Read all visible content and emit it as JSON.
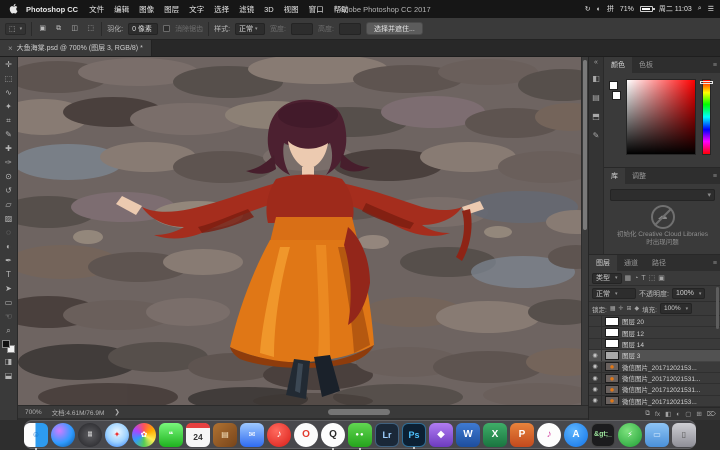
{
  "menubar": {
    "app_name": "Photoshop CC",
    "items": [
      "文件",
      "编辑",
      "图像",
      "图层",
      "文字",
      "选择",
      "滤镜",
      "3D",
      "视图",
      "窗口",
      "帮助"
    ],
    "window_title": "Adobe Photoshop CC 2017",
    "status_icons": {
      "sync": "↻",
      "display": "◐",
      "input": "拼",
      "search": "⌕",
      "notification": "☰"
    },
    "battery_pct": "71%",
    "clock": "周二 11:03"
  },
  "options_bar": {
    "tool_glyph": "⬚",
    "modes": [
      "▣",
      "⧉",
      "◫",
      "⬚"
    ],
    "feather_label": "羽化:",
    "feather_value": "0 像素",
    "antialias_label": "消除锯齿",
    "style_label": "样式:",
    "style_value": "正常",
    "width_label": "宽度:",
    "height_label": "高度:",
    "select_mask_button": "选择并遮住..."
  },
  "document_tab": {
    "close": "×",
    "title": "大鱼海棠.psd @ 700% (图层 3, RGB/8) *"
  },
  "tools": [
    {
      "name": "move-tool",
      "glyph": "✛"
    },
    {
      "name": "marquee-tool",
      "glyph": "⬚"
    },
    {
      "name": "lasso-tool",
      "glyph": "∿"
    },
    {
      "name": "magic-wand-tool",
      "glyph": "✦"
    },
    {
      "name": "crop-tool",
      "glyph": "⌗"
    },
    {
      "name": "eyedropper-tool",
      "glyph": "✎"
    },
    {
      "name": "healing-brush-tool",
      "glyph": "✚"
    },
    {
      "name": "brush-tool",
      "glyph": "✑"
    },
    {
      "name": "clone-stamp-tool",
      "glyph": "⊙"
    },
    {
      "name": "history-brush-tool",
      "glyph": "↺"
    },
    {
      "name": "eraser-tool",
      "glyph": "▱"
    },
    {
      "name": "gradient-tool",
      "glyph": "▨"
    },
    {
      "name": "blur-tool",
      "glyph": "◌"
    },
    {
      "name": "dodge-tool",
      "glyph": "◐"
    },
    {
      "name": "pen-tool",
      "glyph": "✒"
    },
    {
      "name": "type-tool",
      "glyph": "T"
    },
    {
      "name": "path-select-tool",
      "glyph": "➤"
    },
    {
      "name": "shape-tool",
      "glyph": "▭"
    },
    {
      "name": "hand-tool",
      "glyph": "☜"
    },
    {
      "name": "zoom-tool",
      "glyph": "⌕"
    },
    {
      "name": "quick-mask-tool",
      "glyph": "◨"
    },
    {
      "name": "screen-mode-tool",
      "glyph": "⬓"
    }
  ],
  "status_bar": {
    "zoom": "700%",
    "doc_info": "文档:4.61M/76.9M",
    "arrow": "❯"
  },
  "panels": {
    "collapse_arrow": "«",
    "collapsed_icons": [
      "◧",
      "▤",
      "⬒",
      "✎"
    ],
    "color": {
      "tabs": [
        "颜色",
        "色板"
      ],
      "menu_icon": "≡"
    },
    "libraries": {
      "tabs": [
        "库",
        "调整"
      ],
      "menu_icon": "≡",
      "dd_caret": "▾",
      "cloud_glyph": "☁",
      "error_message": "初始化 Creative Cloud Libraries 时出现问题"
    },
    "layers": {
      "tabs": [
        "图层",
        "通道",
        "路径"
      ],
      "menu_icon": "≡",
      "filter_label": "类型",
      "filter_caret": "▾",
      "filter_icons": [
        "▦",
        "◔",
        "T",
        "⬚",
        "▣"
      ],
      "blend_mode": "正常",
      "opacity_label": "不透明度:",
      "opacity_value": "100%",
      "lock_label": "锁定:",
      "lock_icons": [
        "▦",
        "✛",
        "⊞",
        "◆"
      ],
      "fill_label": "填充:",
      "fill_value": "100%",
      "eye_glyph": "◉",
      "rows": [
        {
          "name": "图层 20"
        },
        {
          "name": "图层 12"
        },
        {
          "name": "图层 14"
        },
        {
          "name": "图层 3"
        },
        {
          "name": "微信图片_20171202153..."
        },
        {
          "name": "微信图片_201712021531..."
        },
        {
          "name": "微信图片_201712021531..."
        },
        {
          "name": "微信图片_20171202153..."
        }
      ],
      "bottom_icons": [
        "⧉",
        "fx",
        "◧",
        "◐",
        "▢",
        "⊞",
        "⌦"
      ]
    }
  },
  "dock": {
    "items": [
      {
        "name": "finder",
        "glyph": "☺"
      },
      {
        "name": "siri",
        "glyph": ""
      },
      {
        "name": "launchpad",
        "glyph": "⠿"
      },
      {
        "name": "safari",
        "glyph": "✦"
      },
      {
        "name": "photos",
        "glyph": "✿"
      },
      {
        "name": "messages",
        "glyph": "❝"
      },
      {
        "name": "calendar",
        "glyph": "24"
      },
      {
        "name": "books",
        "glyph": "▤"
      },
      {
        "name": "mail",
        "glyph": "✉"
      },
      {
        "name": "netease-music",
        "glyph": "♪"
      },
      {
        "name": "opera",
        "glyph": "O"
      },
      {
        "name": "qq",
        "glyph": "Q"
      },
      {
        "name": "wechat",
        "glyph": "●●"
      },
      {
        "name": "lightroom",
        "glyph": "Lr"
      },
      {
        "name": "photoshop",
        "glyph": "Ps"
      },
      {
        "name": "app-purple",
        "glyph": "◆"
      },
      {
        "name": "word",
        "glyph": "W"
      },
      {
        "name": "excel",
        "glyph": "X"
      },
      {
        "name": "powerpoint",
        "glyph": "P"
      },
      {
        "name": "itunes",
        "glyph": "♪"
      },
      {
        "name": "app-store",
        "glyph": "A"
      },
      {
        "name": "terminal",
        "glyph": "&gt;_"
      },
      {
        "name": "battery-app",
        "glyph": "⚡"
      },
      {
        "name": "folder",
        "glyph": "▭"
      },
      {
        "name": "trash",
        "glyph": "▯"
      }
    ]
  }
}
